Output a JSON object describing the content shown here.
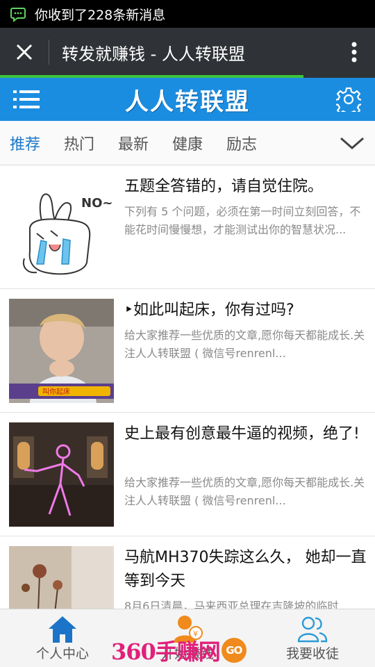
{
  "status_bar": {
    "notification": "你收到了228条新消息"
  },
  "title_bar": {
    "title": "转发就赚钱 - 人人转联盟"
  },
  "load_progress": 0.81,
  "app_bar": {
    "brand": "人人转联盟"
  },
  "tabs": [
    {
      "label": "推荐",
      "active": true
    },
    {
      "label": "热门",
      "active": false
    },
    {
      "label": "最新",
      "active": false
    },
    {
      "label": "健康",
      "active": false
    },
    {
      "label": "励志",
      "active": false
    }
  ],
  "articles": [
    {
      "title": "五题全答错的，请自觉住院。",
      "desc": "下列有 5 个问题，必须在第一时间立刻回答，不能花时间慢慢想，才能测试出你的智慧状况...",
      "thumb_text": "NO~"
    },
    {
      "title": "‣如此叫起床，你有过吗?",
      "desc": "给大家推荐一些优质的文章,愿你每天都能成长.关注人人转联盟 ( 微信号renrenl...",
      "thumb_text": "叫你起床"
    },
    {
      "title": "史上最有创意最牛逼的视频，绝了!",
      "desc": "给大家推荐一些优质的文章,愿你每天都能成长.关注人人转联盟 ( 微信号renrenl...",
      "thumb_text": ""
    },
    {
      "title": "马航MH370失踪这么久， 她却一直等到今天",
      "desc": "8月6日清晨，马来西亚总理在吉隆坡的临时",
      "thumb_text": ""
    }
  ],
  "bottom_nav": [
    {
      "label": "个人中心"
    },
    {
      "label": "开始赚钱"
    },
    {
      "label": "我要收徒"
    }
  ],
  "watermark": {
    "text": "360手赚网",
    "badge": "GO"
  },
  "colors": {
    "accent": "#1b8de1",
    "tab_active": "#1b78c8",
    "progress": "#3cc43c"
  }
}
